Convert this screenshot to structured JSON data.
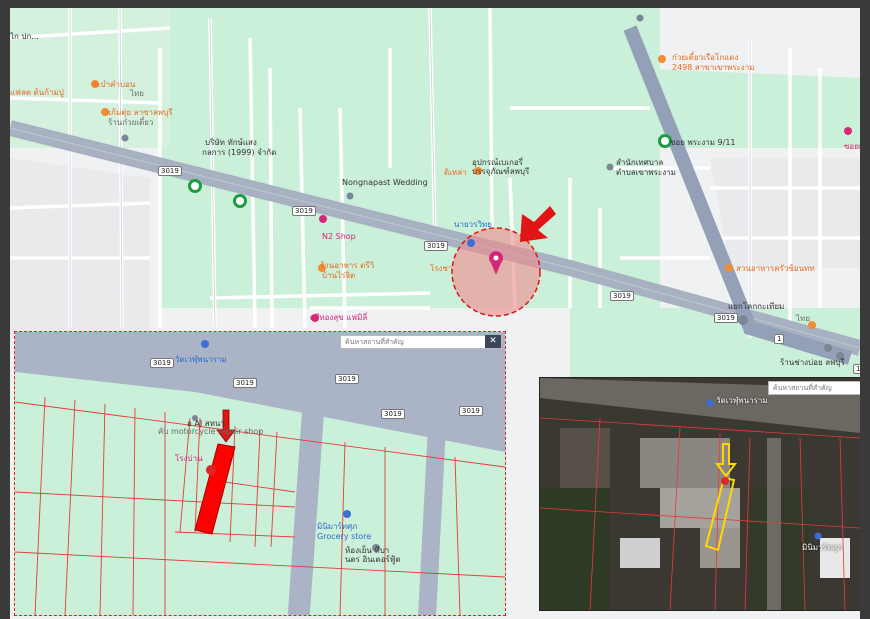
{
  "main_map": {
    "labels": [
      {
        "text": "ไก ปก...",
        "cls": "dark"
      },
      {
        "text": "ระบำคำบอน",
        "cls": "orange"
      },
      {
        "text": "ไทย",
        "cls": "gray"
      },
      {
        "text": "แฟลต ต้นก้ามปู",
        "cls": "orange"
      },
      {
        "text": "แก้มตุ่ย ลาซาลพบุรี",
        "cls": "orange"
      },
      {
        "text": "ร้านก๋วยเตี๋ยว",
        "cls": "gray"
      },
      {
        "text": "บริษัท ทักษ์แสง",
        "cls": "dark"
      },
      {
        "text": "กลการ (1999) จำกัด",
        "cls": "dark"
      },
      {
        "text": "Nongnapast Wedding",
        "cls": "dark"
      },
      {
        "text": "อุปกรณ์เบเกอรี่",
        "cls": "dark"
      },
      {
        "text": "บรรจุภัณฑ์ลพบุรี",
        "cls": "dark"
      },
      {
        "text": "ดิเหล่า",
        "cls": "orange"
      },
      {
        "text": "ก๋วยเตี๋ยวเรือโกแดง",
        "cls": "orange"
      },
      {
        "text": "2498 สาขาเขาพระงาม",
        "cls": "orange"
      },
      {
        "text": "ซอย พระงาม 9/11",
        "cls": "dark"
      },
      {
        "text": "สำนักเทศบาล",
        "cls": "dark"
      },
      {
        "text": "ตำบลเขาพระงาม",
        "cls": "dark"
      },
      {
        "text": "ซอยเข",
        "cls": "pink"
      },
      {
        "text": "N2 Shop",
        "cls": "pink"
      },
      {
        "text": "นายวรวิทย",
        "cls": "blue"
      },
      {
        "text": "ร้านอาหาร ตรีวิ",
        "cls": "orange"
      },
      {
        "text": "บ้านไร่จิต",
        "cls": "orange"
      },
      {
        "text": "โรงชา",
        "cls": "orange"
      },
      {
        "text": "สวนอาหารครัวซ้อนทท",
        "cls": "orange"
      },
      {
        "text": "แยกโคกกะเทียม",
        "cls": "dark"
      },
      {
        "text": "ไทย",
        "cls": "gray"
      },
      {
        "text": "ศรีทองสุข แฟมิลี่",
        "cls": "pink"
      },
      {
        "text": "ร้านช่างบ่อย ลพบุรี",
        "cls": "dark"
      }
    ],
    "shields": [
      "3019",
      "3019",
      "3019",
      "3019",
      "3019",
      "1",
      "1"
    ]
  },
  "inset_left": {
    "search_placeholder": "ค้นหาสถานที่สำคัญ",
    "close_label": "✕",
    "labels": [
      {
        "text": "วัดเวฬุพนาราม",
        "cls": "blue"
      },
      {
        "text": "อ AJ สหนา",
        "cls": "dark"
      },
      {
        "text": "คับ motorcycle repair shop",
        "cls": "gray"
      },
      {
        "text": "โรงบ่าน",
        "cls": "pink"
      },
      {
        "text": "มินิมาร์ทศุภ",
        "cls": "blue"
      },
      {
        "text": "Grocery store",
        "cls": "blue"
      },
      {
        "text": "ห้องเย็น ทีบา",
        "cls": "dark"
      },
      {
        "text": "นตร อินเตอร์ฟู้ด",
        "cls": "dark"
      }
    ],
    "shields": [
      "3019",
      "3019",
      "3019",
      "3019",
      "3019"
    ]
  },
  "inset_right": {
    "search_placeholder": "ค้นหาสถานที่สำคัญ",
    "labels": [
      {
        "text": "วัดเวฬุพนาราม",
        "cls": "white"
      },
      {
        "text": "มินิมาร์ทศุภ",
        "cls": "white"
      }
    ]
  },
  "colors": {
    "accent_red": "#e01515",
    "marker_pink": "#d6277a",
    "highlight_yellow": "#ffd800",
    "road": "#aab4c6",
    "green": "#cbf0d9"
  }
}
